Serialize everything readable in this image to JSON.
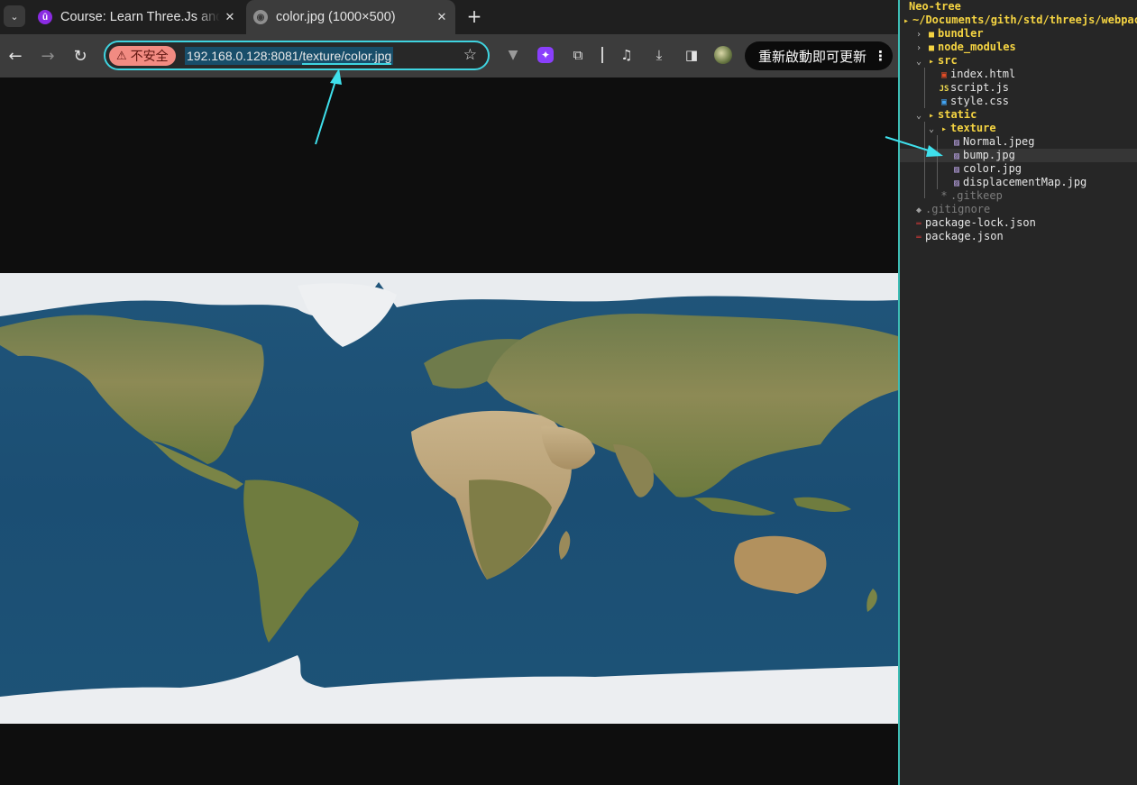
{
  "browser": {
    "tabs": [
      {
        "title": "Course: Learn Three.Js and",
        "favicon": "udemy-u-icon",
        "favicon_glyph": "û",
        "active": false
      },
      {
        "title": "color.jpg (1000×500)",
        "favicon": "globe-icon",
        "favicon_glyph": "◉",
        "active": true
      }
    ],
    "new_tab_glyph": "+",
    "close_glyph": "✕",
    "tab_list_glyph": "⌄",
    "nav": {
      "back": "←",
      "forward": "→",
      "reload": "↻"
    },
    "omnibox": {
      "security_label": "不安全",
      "security_glyph": "⚠",
      "url_host": "192.168.0.128:8081/",
      "url_path": "texture/color.jpg",
      "bookmark_glyph": "☆"
    },
    "extensions": [
      "vivaldi-v-icon",
      "purple-extension-icon",
      "puzzle-icon",
      "media-controls-icon",
      "download-icon",
      "side-panel-icon",
      "profile-avatar"
    ],
    "extension_glyphs": {
      "v": "▼",
      "purple": "✦",
      "puzzle": "⧉",
      "media": "♫",
      "download": "⤓",
      "panel": "◨"
    },
    "update_button": {
      "label": "重新啟動即可更新",
      "menu_glyph": "⋮"
    }
  },
  "viewer": {
    "image_name": "color.jpg",
    "image_size": "1000×500",
    "image_alt": "world map texture"
  },
  "neotree": {
    "title": "Neo-tree",
    "root_path": "~/Documents/gith/std/threejs/webpack",
    "entries": [
      {
        "name": "bundler",
        "type": "dir",
        "expanded": false,
        "depth": 0
      },
      {
        "name": "node_modules",
        "type": "dir",
        "expanded": false,
        "depth": 0
      },
      {
        "name": "src",
        "type": "dir",
        "expanded": true,
        "depth": 0
      },
      {
        "name": "index.html",
        "type": "html",
        "depth": 1
      },
      {
        "name": "script.js",
        "type": "js",
        "depth": 1
      },
      {
        "name": "style.css",
        "type": "css",
        "depth": 1
      },
      {
        "name": "static",
        "type": "dir",
        "expanded": true,
        "depth": 0
      },
      {
        "name": "texture",
        "type": "dir",
        "expanded": true,
        "depth": 1
      },
      {
        "name": "Normal.jpeg",
        "type": "img",
        "depth": 2
      },
      {
        "name": "bump.jpg",
        "type": "img",
        "depth": 2,
        "selected": true
      },
      {
        "name": "color.jpg",
        "type": "img",
        "depth": 2
      },
      {
        "name": "displacementMap.jpg",
        "type": "img",
        "depth": 2
      },
      {
        "name": ".gitkeep",
        "type": "hidden",
        "depth": 1
      },
      {
        "name": ".gitignore",
        "type": "git",
        "depth": 0
      },
      {
        "name": "package-lock.json",
        "type": "npm",
        "depth": 0
      },
      {
        "name": "package.json",
        "type": "npm",
        "depth": 0
      }
    ]
  },
  "colors": {
    "accent_cyan": "#3fd4e0",
    "neotree_dir": "#f5d442",
    "insecure_chip": "#f28b82"
  }
}
